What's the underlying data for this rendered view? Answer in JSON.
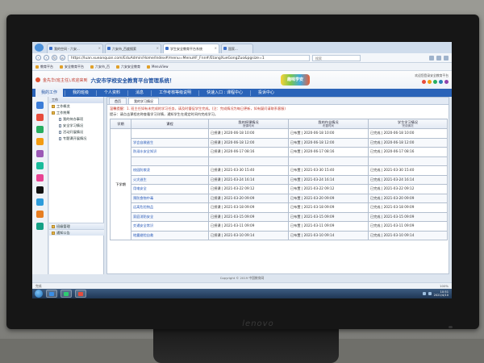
{
  "monitor": {
    "brand": "lenovo"
  },
  "browser": {
    "tabs": [
      {
        "label": "我的空间 - 六安..."
      },
      {
        "label": "六安市_百度搜索"
      },
      {
        "label": "学生安全教育平台系统",
        "active": true
      },
      {
        "label": "国家..."
      }
    ],
    "url": "https://luan.xueanquan.com/EduAdmin/Home/Index#/menu=MenuHF_Fnn#/EtangXueGongZuo&pgsize=1",
    "search_placeholder": "搜索",
    "bookmarks": [
      "教育平台",
      "安全教育平台",
      "六安市_百",
      "六安安全教育",
      "MenuView"
    ]
  },
  "app": {
    "welcome": "金先华(班主任),欢迎来到",
    "title": "六安市学校安全教育平台管理系统！",
    "badge": "趣味学安",
    "header_right": "欢迎您登录安全教育平台",
    "nav": [
      {
        "label": "我的工作",
        "active": true
      },
      {
        "label": "我的班级"
      },
      {
        "label": "个人资料"
      },
      {
        "label": "消息"
      },
      {
        "label": "工作考核等级说明"
      },
      {
        "label": "快速入口 : 课程中心"
      },
      {
        "label": "投诉中心"
      }
    ]
  },
  "sidebar": {
    "header": "工作",
    "items": [
      {
        "label": "工作概览",
        "level": 0
      },
      {
        "label": "工作统筹",
        "level": 0
      },
      {
        "label": "我的待办事项",
        "level": 1
      },
      {
        "label": "安全学习情况",
        "level": 1
      },
      {
        "label": "活动开展情况",
        "level": 1
      },
      {
        "label": "专题课开展情况",
        "level": 1
      }
    ],
    "bottom": [
      {
        "label": "班级管理"
      },
      {
        "label": "通知公告"
      }
    ]
  },
  "main": {
    "tabs": [
      {
        "label": "首页"
      },
      {
        "label": "我的学习情况",
        "active": true
      }
    ],
    "notice_red": "温馨提醒：1. 班主任如有未完成的学习任务，请及时督促学生完成。(注：完成情况为每日更新，如有疑问请联系客服)",
    "notice_black": "提示：请点击课程名称查看学习详情，通知学生在规定时间内完成学习。",
    "table": {
      "headers": [
        {
          "main": "学期"
        },
        {
          "main": "课程"
        },
        {
          "main": "我的授课情况",
          "sub": "授课时间"
        },
        {
          "main": "我的作业情况",
          "sub": "布置时间"
        },
        {
          "main": "学生学习情况",
          "sub": "完成情况"
        }
      ],
      "term": "下学期",
      "rows": [
        {
          "course": "",
          "teach": "已授课 | 2020-06-18 10:00",
          "assign": "已布置 | 2020-06-18 10:00",
          "study": "已完成 | 2020-06-18 10:00"
        },
        {
          "course": "学会自救逃生",
          "teach": "已授课 | 2020-06-18 12:00",
          "assign": "已布置 | 2020-06-18 12:00",
          "study": "已完成 | 2020-06-18 12:00"
        },
        {
          "course": "防溺水安全知识",
          "teach": "已授课 | 2020-06-17 08:16",
          "assign": "已布置 | 2020-06-17 08:16",
          "study": "已完成 | 2020-06-17 08:16"
        },
        {
          "course": "",
          "teach": "",
          "assign": "",
          "study": ""
        },
        {
          "course": "校园防欺凌",
          "teach": "已授课 | 2021-03-30 15:40",
          "assign": "已布置 | 2021-03-30 15:40",
          "study": "已完成 | 2021-03-30 15:40"
        },
        {
          "course": "火灾逃生",
          "teach": "已授课 | 2021-03-24 16:14",
          "assign": "已布置 | 2021-03-24 16:14",
          "study": "已完成 | 2021-03-24 16:14"
        },
        {
          "course": "用电安全",
          "teach": "已授课 | 2021-03-22 09:12",
          "assign": "已布置 | 2021-03-22 09:12",
          "study": "已完成 | 2021-03-22 09:12"
        },
        {
          "course": "预防食物中毒",
          "teach": "已授课 | 2021-03-20 09:09",
          "assign": "已布置 | 2021-03-20 09:09",
          "study": "已完成 | 2021-03-20 09:09"
        },
        {
          "course": "远离危险物品",
          "teach": "已授课 | 2021-03-18 09:09",
          "assign": "已布置 | 2021-03-18 09:09",
          "study": "已完成 | 2021-03-18 09:09"
        },
        {
          "course": "家庭消防安全",
          "teach": "已授课 | 2021-03-15 09:09",
          "assign": "已布置 | 2021-03-15 09:09",
          "study": "已完成 | 2021-03-15 09:09"
        },
        {
          "course": "交通安全常识",
          "teach": "已授课 | 2021-03-11 09:09",
          "assign": "已布置 | 2021-03-11 09:09",
          "study": "已完成 | 2021-03-11 09:09"
        },
        {
          "course": "地震避险自救",
          "teach": "已授课 | 2021-03-10 09:14",
          "assign": "已布置 | 2021-03-10 09:14",
          "study": "已完成 | 2021-03-10 09:14"
        }
      ]
    }
  },
  "footer": "Copyright © 2019 中国教育网",
  "statusbar": [
    "完成",
    "100%"
  ],
  "taskbar": {
    "time": "10:51",
    "date": "2021/4/10"
  }
}
